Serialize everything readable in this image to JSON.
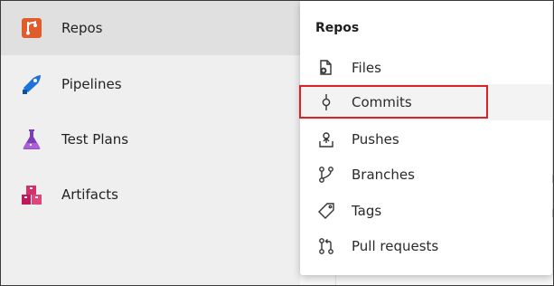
{
  "sidebar": {
    "items": [
      {
        "label": "Repos",
        "icon": "repos-icon",
        "color": "#e05c2c"
      },
      {
        "label": "Pipelines",
        "icon": "pipelines-icon",
        "color": "#1e73d8"
      },
      {
        "label": "Test Plans",
        "icon": "test-plans-icon",
        "color": "#7a3fb5"
      },
      {
        "label": "Artifacts",
        "icon": "artifacts-icon",
        "color": "#c2185b"
      }
    ]
  },
  "flyout": {
    "title": "Repos",
    "items": [
      {
        "label": "Files",
        "icon": "files-icon"
      },
      {
        "label": "Commits",
        "icon": "commits-icon",
        "highlighted": true
      },
      {
        "label": "Pushes",
        "icon": "pushes-icon"
      },
      {
        "label": "Branches",
        "icon": "branches-icon"
      },
      {
        "label": "Tags",
        "icon": "tags-icon"
      },
      {
        "label": "Pull requests",
        "icon": "pull-requests-icon"
      }
    ]
  },
  "colors": {
    "highlight_border": "#d9232a",
    "sidebar_bg": "#efefef",
    "selected_bg": "#e0e0e0"
  }
}
